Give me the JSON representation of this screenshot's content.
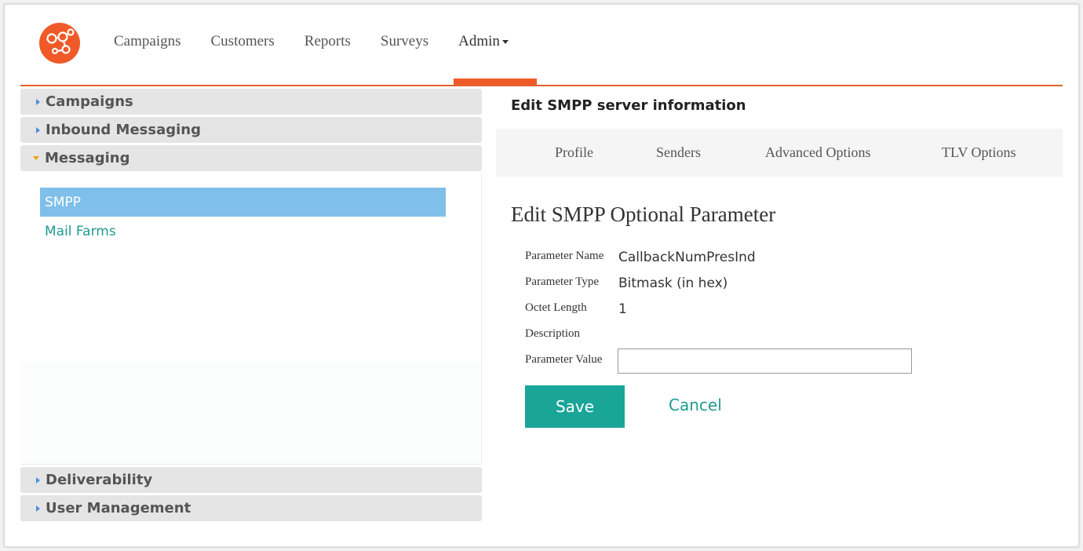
{
  "logo": {
    "icon": "molecule-logo-icon",
    "color": "#f05a28"
  },
  "topnav": {
    "items": [
      {
        "label": "Campaigns"
      },
      {
        "label": "Customers"
      },
      {
        "label": "Reports"
      },
      {
        "label": "Surveys"
      },
      {
        "label": "Admin",
        "active": true
      }
    ],
    "accent_color": "#f05a28"
  },
  "sidebar": {
    "sections": [
      {
        "label": "Campaigns",
        "expanded": false
      },
      {
        "label": "Inbound Messaging",
        "expanded": false
      },
      {
        "label": "Messaging",
        "expanded": true,
        "items": [
          {
            "label": "SMPP",
            "selected": true
          },
          {
            "label": "Mail Farms",
            "selected": false
          }
        ]
      },
      {
        "label": "Deliverability",
        "expanded": false
      },
      {
        "label": "User Management",
        "expanded": false
      }
    ],
    "selected_color": "#80bfea",
    "link_color": "#1f9b8f"
  },
  "main": {
    "heading": "Edit SMPP server information",
    "tabs": [
      {
        "label": "Profile"
      },
      {
        "label": "Senders"
      },
      {
        "label": "Advanced Options"
      },
      {
        "label": "TLV Options"
      }
    ],
    "form": {
      "title": "Edit SMPP Optional Parameter",
      "fields": [
        {
          "label": "Parameter Name",
          "value": "CallbackNumPresInd"
        },
        {
          "label": "Parameter Type",
          "value": "Bitmask (in hex)"
        },
        {
          "label": "Octet Length",
          "value": "1"
        },
        {
          "label": "Description",
          "value": ""
        },
        {
          "label": "Parameter Value",
          "input_value": "",
          "placeholder": ""
        }
      ],
      "save_label": "Save",
      "cancel_label": "Cancel",
      "button_color": "#1aa599"
    }
  }
}
